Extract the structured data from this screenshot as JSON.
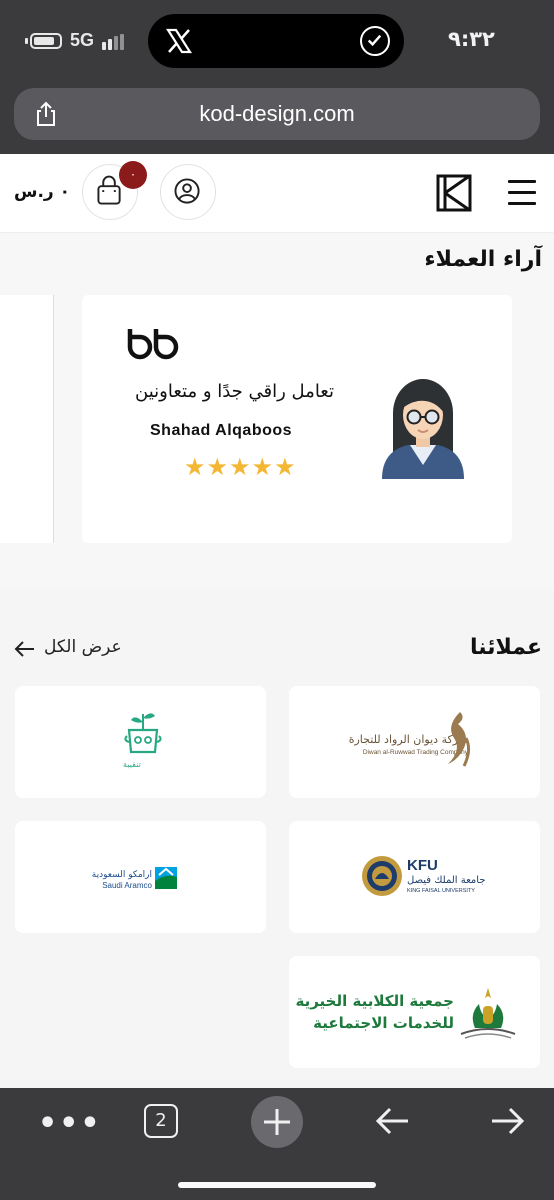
{
  "status_bar": {
    "network": "5G",
    "time": "٩:٣٢",
    "island_app_icon": "x-logo-icon",
    "island_status_icon": "check-circle-icon"
  },
  "browser": {
    "url": "kod-design.com",
    "share_icon": "share-icon"
  },
  "header": {
    "cart_total": "٠ ر.س",
    "cart_count": "٠",
    "cart_icon": "shopping-bag-icon",
    "account_icon": "user-circle-icon",
    "logo_icon": "kod-logo-icon",
    "menu_icon": "hamburger-menu-icon"
  },
  "testimonials": {
    "title": "آراء العملاء",
    "items": [
      {
        "quote": "تعامل راقي جدًا و متعاونين",
        "author": "Shahad Alqaboos",
        "rating": 5
      }
    ]
  },
  "clients": {
    "title": "عملائنا",
    "view_all": "عرض الكل",
    "items": [
      {
        "name": "شركة ديوان الرواد للتجارة",
        "subtitle": "Diwan al-Ruwwad Trading Company"
      },
      {
        "name": "تنقيبة"
      },
      {
        "name": "جامعة الملك فيصل",
        "subtitle": "KING FAISAL UNIVERSITY",
        "abbr": "KFU"
      },
      {
        "name": "ارامكو السعودية",
        "subtitle": "Saudi Aramco"
      },
      {
        "name": "جمعية الكلابية الخيرية",
        "subtitle": "للخدمات الاجتماعية"
      }
    ]
  },
  "toolbar": {
    "tab_count": "2",
    "more_icon": "more-dots-icon",
    "new_tab_icon": "plus-icon",
    "back_icon": "arrow-left-icon",
    "forward_icon": "arrow-right-icon"
  },
  "colors": {
    "badge": "#8b1a1a",
    "star": "#f4b733",
    "chrome": "#3b3b3d",
    "client_green": "#1e7a3c"
  }
}
